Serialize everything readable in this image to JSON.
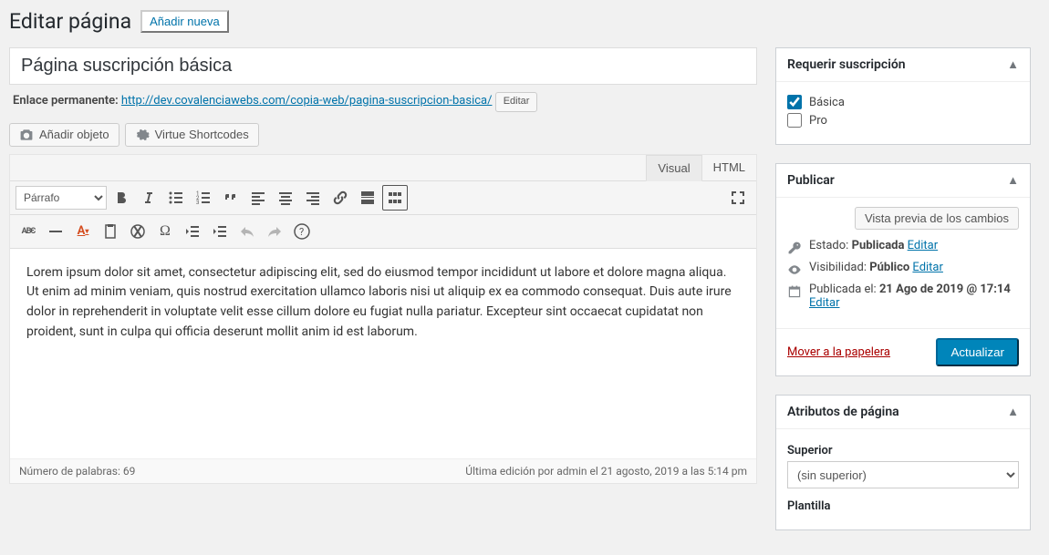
{
  "header": {
    "title": "Editar página",
    "add_new": "Añadir nueva"
  },
  "title_input": "Página suscripción básica",
  "permalink": {
    "label": "Enlace permanente:",
    "url": "http://dev.covalenciawebs.com/copia-web/pagina-suscripcion-basica/",
    "edit": "Editar"
  },
  "media": {
    "add_object": "Añadir objeto",
    "virtue": "Virtue Shortcodes"
  },
  "editor": {
    "tab_visual": "Visual",
    "tab_html": "HTML",
    "format_select": "Párrafo",
    "content": "Lorem ipsum dolor sit amet, consectetur adipiscing elit, sed do eiusmod tempor incididunt ut labore et dolore magna aliqua. Ut enim ad minim veniam, quis nostrud exercitation ullamco laboris nisi ut aliquip ex ea commodo consequat. Duis aute irure dolor in reprehenderit in voluptate velit esse cillum dolore eu fugiat nulla pariatur. Excepteur sint occaecat cupidatat non proident, sunt in culpa qui officia deserunt mollit anim id est laborum.",
    "word_count_label": "Número de palabras:",
    "word_count": "69",
    "last_edit": "Última edición por admin el 21 agosto, 2019 a las 5:14 pm"
  },
  "sidebar": {
    "subscription": {
      "title": "Requerir suscripción",
      "opt_basic": "Básica",
      "opt_pro": "Pro"
    },
    "publish": {
      "title": "Publicar",
      "preview": "Vista previa de los cambios",
      "status_label": "Estado:",
      "status_value": "Publicada",
      "visibility_label": "Visibilidad:",
      "visibility_value": "Público",
      "published_label": "Publicada el:",
      "published_value": "21 Ago de 2019 @ 17:14",
      "edit": "Editar",
      "trash": "Mover a la papelera",
      "update": "Actualizar"
    },
    "attributes": {
      "title": "Atributos de página",
      "parent_label": "Superior",
      "parent_value": "(sin superior)",
      "template_label": "Plantilla"
    }
  }
}
